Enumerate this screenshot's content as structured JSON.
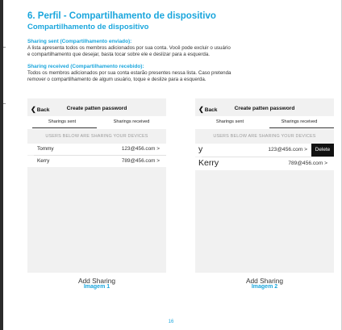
{
  "heading": {
    "title": "6. Perfil - Compartilhamento de dispositivo",
    "subtitle": "Compartilhamento de dispositivo"
  },
  "sections": [
    {
      "heading": "Sharing sent (Compartilhamento enviado):",
      "lines": [
        "A lista apresenta todos os membros adicionados por sua conta. Você pode excluir o usuário",
        "e compartilhamento que desejar, basta tocar sobre ele e deslizar para a esquerda."
      ]
    },
    {
      "heading": "Sharing received (Compartilhamento recebido):",
      "lines": [
        "Todos os membros adicionados por sua conta estarão presentes nessa lista. Caso pretenda",
        "remover o compartilhamento de algum usuário, toque e deslize para a esquerda."
      ]
    }
  ],
  "phone1": {
    "back": "Back",
    "title": "Create patten password",
    "tabs": [
      "Sharings sent",
      "Sharings received"
    ],
    "hint": "USERS BELOW ARE SHARING YOUR DEVICES",
    "rows": [
      {
        "name": "Tommy",
        "email": "123@456.com >"
      },
      {
        "name": "Kerry",
        "email": "789@456.com >"
      }
    ],
    "add": "Add Sharing",
    "caption": "Imagem 1"
  },
  "phone2": {
    "back": "Back",
    "title": "Create patten password",
    "tabs": [
      "Sharings sent",
      "Sharings received"
    ],
    "hint": "USERS BELOW ARE SHARING YOUR DEVICES",
    "rows": [
      {
        "name": "y",
        "email": "123@456.com >",
        "delete": "Delete"
      },
      {
        "name": "Kerry",
        "email": "789@456.com >"
      }
    ],
    "add": "Add Sharing",
    "caption": "Imagem 2"
  },
  "page_number": "16",
  "colors": {
    "accent": "#1aa6dd",
    "phone_bg": "#f1f1f1",
    "delete_bg": "#111111"
  }
}
